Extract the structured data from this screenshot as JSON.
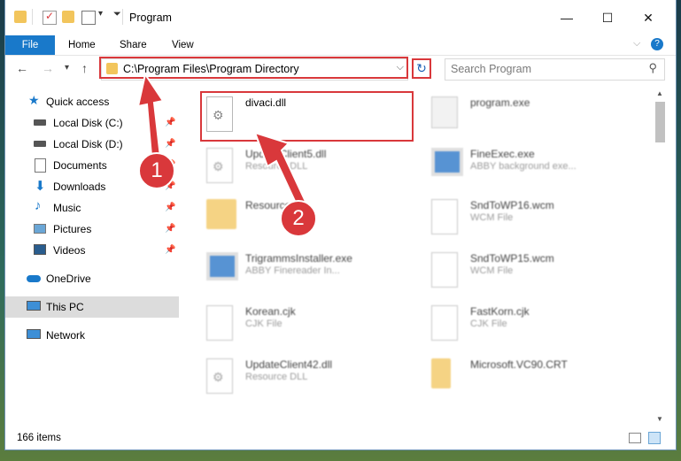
{
  "window": {
    "title": "Program"
  },
  "ribbon": {
    "tabs": [
      "File",
      "Home",
      "Share",
      "View"
    ]
  },
  "address": {
    "path": "C:\\Program Files\\Program Directory"
  },
  "search": {
    "placeholder": "Search Program"
  },
  "sidebar": {
    "items": [
      {
        "label": "Quick access",
        "icon": "star-icon"
      },
      {
        "label": "Local Disk (C:)",
        "icon": "disk-icon",
        "pinned": true
      },
      {
        "label": "Local Disk (D:)",
        "icon": "disk-icon",
        "pinned": true
      },
      {
        "label": "Documents",
        "icon": "documents-icon",
        "pinned": true
      },
      {
        "label": "Downloads",
        "icon": "download-icon",
        "pinned": true
      },
      {
        "label": "Music",
        "icon": "music-icon",
        "pinned": true
      },
      {
        "label": "Pictures",
        "icon": "pictures-icon",
        "pinned": true
      },
      {
        "label": "Videos",
        "icon": "videos-icon",
        "pinned": true
      },
      {
        "label": "OneDrive",
        "icon": "cloud-icon"
      },
      {
        "label": "This PC",
        "icon": "computer-icon",
        "selected": true
      },
      {
        "label": "Network",
        "icon": "network-icon"
      }
    ]
  },
  "files": [
    {
      "name": "divaci.dll",
      "type": "",
      "icon": "dll-gear-icon"
    },
    {
      "name": "program.exe",
      "type": "",
      "icon": "exe-icon"
    },
    {
      "name": "UpdateClient5.dll",
      "type": "Resource DLL",
      "icon": "dll-gear-icon"
    },
    {
      "name": "FineExec.exe",
      "type": "ABBY background exe...",
      "icon": "app-window-icon"
    },
    {
      "name": "Resources",
      "type": "",
      "icon": "folder-icon"
    },
    {
      "name": "SndToWP16.wcm",
      "type": "WCM File",
      "icon": "document-icon"
    },
    {
      "name": "TrigrammsInstaller.exe",
      "type": "ABBY Finereader In...",
      "icon": "app-window-icon"
    },
    {
      "name": "SndToWP15.wcm",
      "type": "WCM File",
      "icon": "document-icon"
    },
    {
      "name": "Korean.cjk",
      "type": "CJK File",
      "icon": "document-icon"
    },
    {
      "name": "FastKorn.cjk",
      "type": "CJK File",
      "icon": "document-icon"
    },
    {
      "name": "UpdateClient42.dll",
      "type": "Resource DLL",
      "icon": "dll-gear-icon"
    },
    {
      "name": "Microsoft.VC90.CRT",
      "type": "",
      "icon": "folder-icon"
    }
  ],
  "status": {
    "item_count": "166 items"
  },
  "callouts": [
    "1",
    "2"
  ],
  "colors": {
    "accent": "#1979ca",
    "highlight": "#d9383b"
  }
}
